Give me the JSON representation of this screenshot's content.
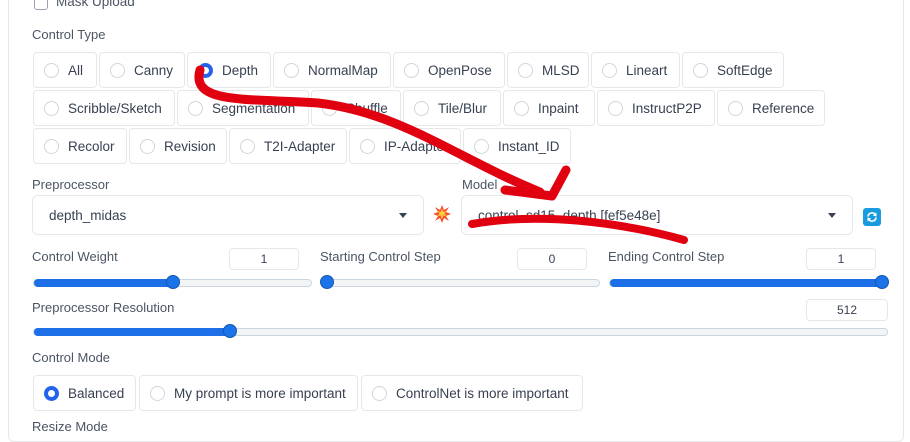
{
  "mask_upload": {
    "label": "Mask Upload",
    "checked": false
  },
  "control_type": {
    "label": "Control Type",
    "selected": "Depth",
    "options": [
      "All",
      "Canny",
      "Depth",
      "NormalMap",
      "OpenPose",
      "MLSD",
      "Lineart",
      "SoftEdge",
      "Scribble/Sketch",
      "Segmentation",
      "Shuffle",
      "Tile/Blur",
      "Inpaint",
      "InstructP2P",
      "Reference",
      "Recolor",
      "Revision",
      "T2I-Adapter",
      "IP-Adapter",
      "Instant_ID"
    ]
  },
  "preprocessor": {
    "label": "Preprocessor",
    "value": "depth_midas",
    "run_icon": "explosion-icon"
  },
  "model": {
    "label": "Model",
    "value": "control_sd15_depth [fef5e48e]",
    "refresh_icon": "refresh-icon"
  },
  "control_weight": {
    "label": "Control Weight",
    "value": "1",
    "fraction": 0.5
  },
  "starting_step": {
    "label": "Starting Control Step",
    "value": "0",
    "fraction": 0.0
  },
  "ending_step": {
    "label": "Ending Control Step",
    "value": "1",
    "fraction": 1.0
  },
  "preprocessor_resolution": {
    "label": "Preprocessor Resolution",
    "value": "512",
    "fraction": 0.23
  },
  "control_mode": {
    "label": "Control Mode",
    "selected": "Balanced",
    "options": [
      "Balanced",
      "My prompt is more important",
      "ControlNet is more important"
    ]
  },
  "resize_mode": {
    "label": "Resize Mode"
  },
  "colors": {
    "accent": "#2563eb",
    "annotation": "#e0000f"
  }
}
